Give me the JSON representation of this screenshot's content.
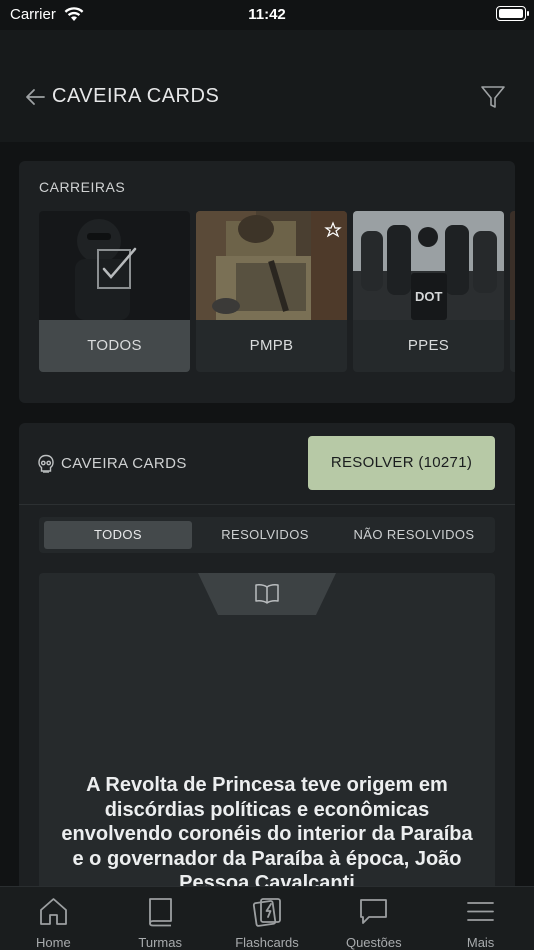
{
  "status_bar": {
    "carrier": "Carrier",
    "time": "11:42"
  },
  "header": {
    "title": "CAVEIRA CARDS"
  },
  "careers": {
    "label": "CARREIRAS",
    "items": [
      {
        "name": "TODOS",
        "selected": true
      },
      {
        "name": "PMPB",
        "selected": false,
        "favorite_icon": "star-outline-icon"
      },
      {
        "name": "PPES",
        "selected": false,
        "badge_text": "DOT"
      }
    ]
  },
  "cards": {
    "section_label": "CAVEIRA CARDS",
    "resolve_button": "RESOLVER (10271)",
    "filters": [
      {
        "label": "TODOS",
        "active": true
      },
      {
        "label": "RESOLVIDOS",
        "active": false
      },
      {
        "label": "NÃO RESOLVIDOS",
        "active": false
      }
    ],
    "question_text": "A Revolta de Princesa teve origem em discórdias políticas e econômicas envolvendo coronéis do interior da Paraíba e o governador da Paraíba à época, João Pessoa Cavalcanti"
  },
  "tab_bar": {
    "items": [
      {
        "label": "Home",
        "icon": "home-icon"
      },
      {
        "label": "Turmas",
        "icon": "book-icon"
      },
      {
        "label": "Flashcards",
        "icon": "flashcards-icon"
      },
      {
        "label": "Questões",
        "icon": "chat-bubble-icon"
      },
      {
        "label": "Mais",
        "icon": "hamburger-menu-icon"
      }
    ]
  },
  "colors": {
    "resolve_button_bg": "#b7c9a6",
    "background": "#111314",
    "panel": "#1d2022"
  }
}
